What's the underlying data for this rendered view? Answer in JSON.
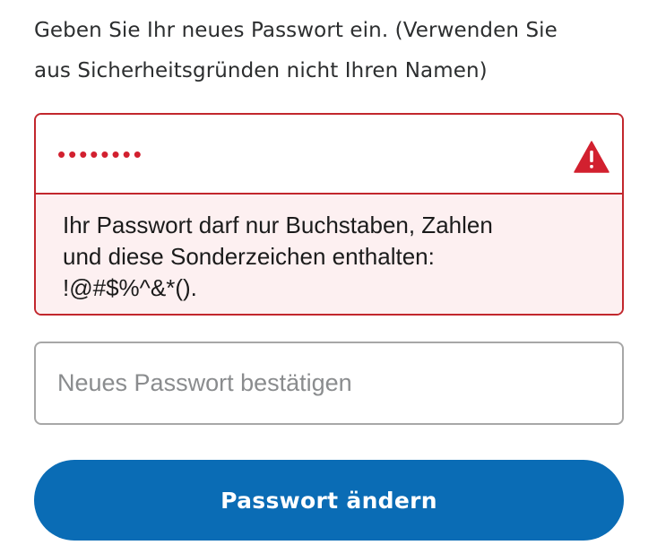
{
  "instructions": {
    "line1": "Geben Sie Ihr neues Passwort ein. (Verwenden Sie",
    "line2": "aus Sicherheitsgründen nicht Ihren Namen)"
  },
  "new_password": {
    "masked_value": "••••••••",
    "state": "error",
    "icon": "warning-triangle-icon",
    "error_lines": [
      "Ihr Passwort darf nur Buchstaben, Zahlen",
      "und diese Sonderzeichen enthalten:",
      "!@#$%^&*()."
    ]
  },
  "confirm_password": {
    "placeholder": "Neues Passwort bestätigen"
  },
  "submit": {
    "label": "Passwort ändern"
  },
  "colors": {
    "error": "#c2272d",
    "error_bg": "#fdf0f1",
    "primary": "#0a6cb5"
  }
}
